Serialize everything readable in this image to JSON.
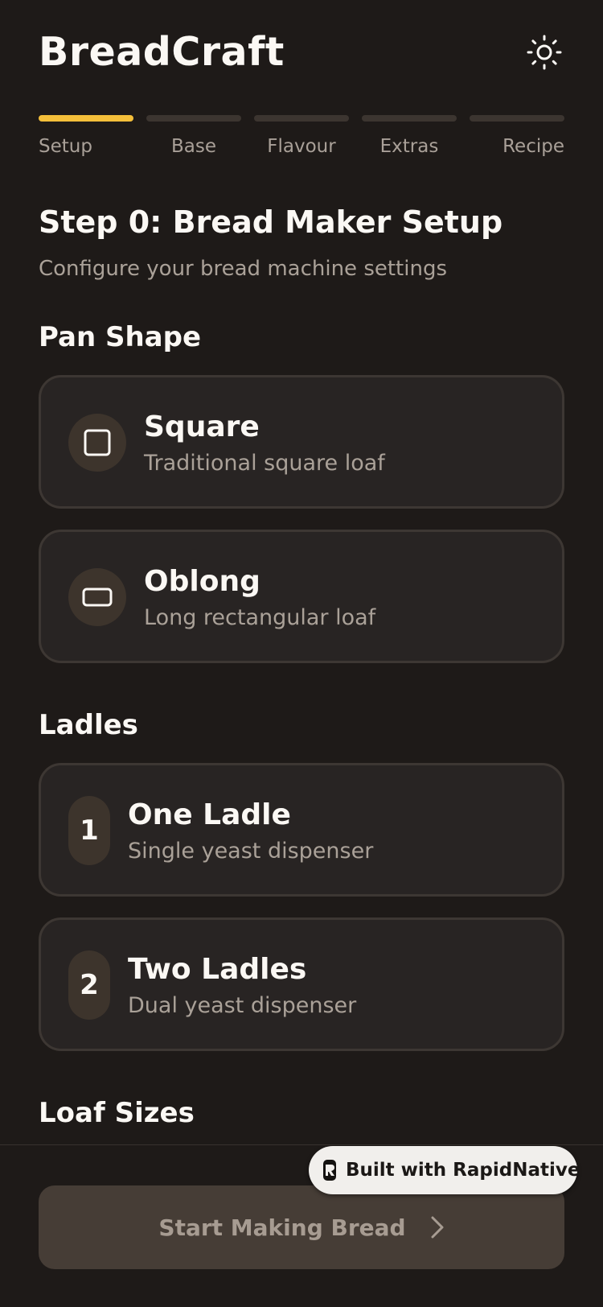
{
  "app": {
    "title": "BreadCraft"
  },
  "stepper": {
    "active_index": 0,
    "steps": [
      {
        "label": "Setup"
      },
      {
        "label": "Base"
      },
      {
        "label": "Flavour"
      },
      {
        "label": "Extras"
      },
      {
        "label": "Recipe"
      }
    ]
  },
  "main": {
    "title": "Step 0: Bread Maker Setup",
    "subtitle": "Configure your bread machine settings",
    "sections": {
      "pan_shape": {
        "title": "Pan Shape",
        "options": [
          {
            "title": "Square",
            "subtitle": "Traditional square loaf",
            "icon": "square-icon"
          },
          {
            "title": "Oblong",
            "subtitle": "Long rectangular loaf",
            "icon": "rectangle-icon"
          }
        ]
      },
      "ladles": {
        "title": "Ladles",
        "options": [
          {
            "number": "1",
            "title": "One Ladle",
            "subtitle": "Single yeast dispenser"
          },
          {
            "number": "2",
            "title": "Two Ladles",
            "subtitle": "Dual yeast dispenser"
          }
        ]
      },
      "loaf_sizes": {
        "title": "Loaf Sizes"
      }
    }
  },
  "footer": {
    "primary_button": "Start Making Bread"
  },
  "badge": {
    "label": "Built with RapidNative"
  },
  "colors": {
    "background": "#1e1a18",
    "card": "#282423",
    "card_border": "#3d3733",
    "accent": "#f4bf3a",
    "muted_text": "#aaa198",
    "button_disabled": "#463d36"
  }
}
